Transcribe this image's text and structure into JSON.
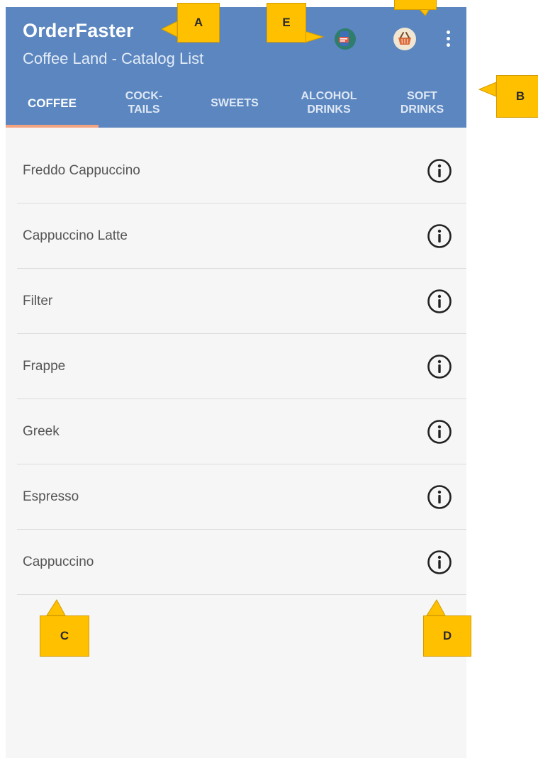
{
  "app": {
    "title": "OrderFaster",
    "subtitle": "Coffee Land - Catalog List"
  },
  "toolbar": {
    "icons": [
      "waiter-call-icon",
      "basket-icon",
      "more-vert-icon"
    ]
  },
  "tabs": [
    {
      "label": "COFFEE",
      "line1": "COFFEE",
      "line2": "",
      "active": true
    },
    {
      "label": "COCKTAILS",
      "line1": "COCK-",
      "line2": "TAILS",
      "active": false
    },
    {
      "label": "SWEETS",
      "line1": "SWEETS",
      "line2": "",
      "active": false
    },
    {
      "label": "ALCOHOL DRINKS",
      "line1": "ALCOHOL",
      "line2": "DRINKS",
      "active": false
    },
    {
      "label": "SOFT DRINKS",
      "line1": "SOFT",
      "line2": "DRINKS",
      "active": false
    }
  ],
  "catalog": {
    "items": [
      {
        "name": "Freddo Cappuccino",
        "icon": "info-icon"
      },
      {
        "name": "Cappuccino Latte",
        "icon": "info-icon"
      },
      {
        "name": "Filter",
        "icon": "info-icon"
      },
      {
        "name": "Frappe",
        "icon": "info-icon"
      },
      {
        "name": "Greek",
        "icon": "info-icon"
      },
      {
        "name": "Espresso",
        "icon": "info-icon"
      },
      {
        "name": "Cappuccino",
        "icon": "info-icon"
      }
    ]
  },
  "annotations": {
    "a": "A",
    "b": "B",
    "c": "C",
    "d": "D",
    "e": "E"
  },
  "colors": {
    "appbar": "#5b86c0",
    "tab_indicator": "#f4a380",
    "callout": "#ffc000",
    "background": "#f6f6f6"
  }
}
